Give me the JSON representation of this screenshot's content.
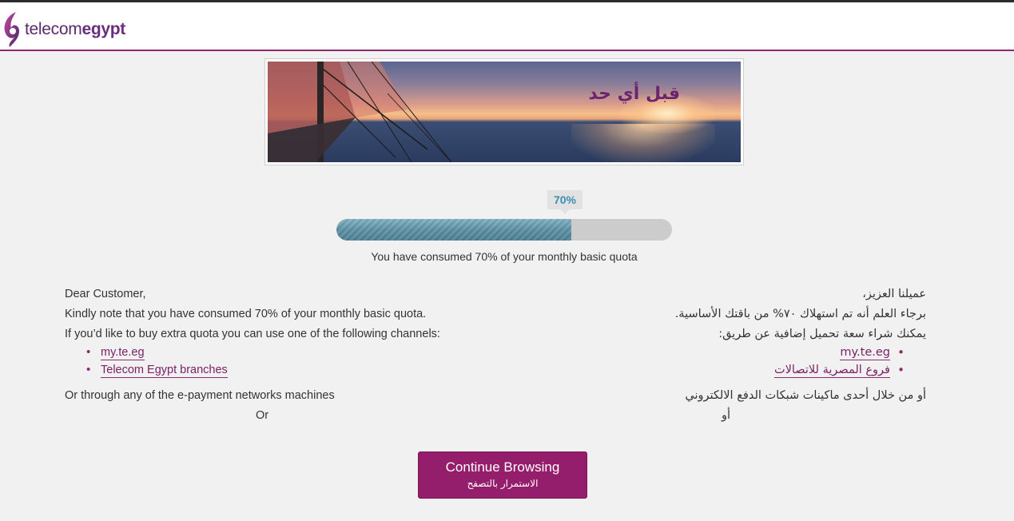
{
  "header": {
    "logo_text_regular": "telecom",
    "logo_text_bold": "egypt",
    "brand_color": "#8c2a73"
  },
  "banner": {
    "headline": "قبل أي حد"
  },
  "quota": {
    "percent_label": "70%",
    "percent_value": 70,
    "consumed_message": "You have consumed 70% of your monthly basic quota",
    "fill_color": "#5e93a6"
  },
  "english": {
    "greeting": "Dear Customer,",
    "note": "Kindly note that you have consumed 70% of your monthly basic quota.",
    "channels_intro": "If you’d like to buy extra quota you can use one of the following channels:",
    "channels": [
      "my.te.eg",
      "Telecom Egypt branches"
    ],
    "epayment": "Or through any of the e-payment networks machines",
    "or": "Or"
  },
  "arabic": {
    "greeting": "عميلنا العزيز،",
    "note": "برجاء العلم أنه تم استهلاك ٧٠% من باقتك الأساسية.",
    "channels_intro": "يمكنك شراء سعة تحميل إضافية عن طريق:",
    "channels": [
      "my.te.eg",
      "فروع المصرية للاتصالات"
    ],
    "epayment": "أو من خلال أحدى ماكينات شبكات الدفع الالكتروني",
    "or": "أو"
  },
  "continue_button": {
    "label_en": "Continue Browsing",
    "label_ar": "الاستمرار بالتصفح",
    "color": "#941d6c"
  }
}
